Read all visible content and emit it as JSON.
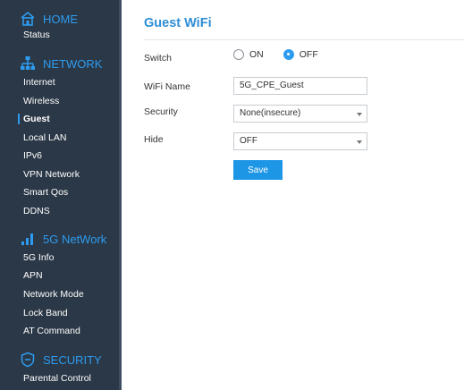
{
  "sidebar": {
    "sections": [
      {
        "title": "HOME",
        "icon": "home-icon",
        "items": [
          "Status"
        ]
      },
      {
        "title": "NETWORK",
        "icon": "network-icon",
        "items": [
          "Internet",
          "Wireless",
          "Guest",
          "Local LAN",
          "IPv6",
          "VPN Network",
          "Smart Qos",
          "DDNS"
        ]
      },
      {
        "title": "5G NetWork",
        "icon": "signal-bars-icon",
        "items": [
          "5G Info",
          "APN",
          "Network Mode",
          "Lock Band",
          "AT Command"
        ]
      },
      {
        "title": "SECURITY",
        "icon": "shield-icon",
        "items": [
          "Parental Control"
        ]
      }
    ],
    "active_item": "Guest"
  },
  "page": {
    "title": "Guest WiFi",
    "switch_label": "Switch",
    "switch_options": [
      "ON",
      "OFF"
    ],
    "switch_value": "OFF",
    "wifi_name_label": "WiFi Name",
    "wifi_name_value": "5G_CPE_Guest",
    "security_label": "Security",
    "security_value": "None(insecure)",
    "hide_label": "Hide",
    "hide_value": "OFF",
    "save_label": "Save"
  },
  "colors": {
    "sidebar_bg": "#2b3847",
    "accent": "#2d9cf0",
    "title": "#2d8ed6",
    "button": "#1e96e6"
  }
}
